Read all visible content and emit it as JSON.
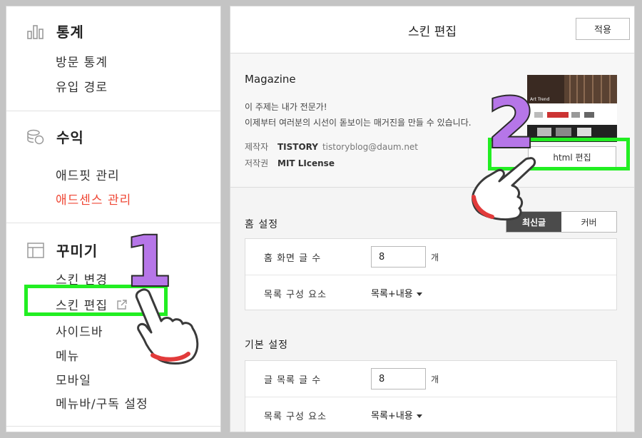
{
  "sidebar": {
    "stats": {
      "title": "통계",
      "icon": "bar-chart-icon",
      "items": [
        "방문 통계",
        "유입 경로"
      ]
    },
    "revenue": {
      "title": "수익",
      "icon": "coins-icon",
      "items": [
        "애드핏 관리",
        "애드센스 관리"
      ]
    },
    "decorate": {
      "title": "꾸미기",
      "icon": "layout-icon",
      "items": [
        "스킨 변경",
        "스킨 편집",
        "사이드바",
        "메뉴",
        "모바일",
        "메뉴바/구독 설정"
      ]
    }
  },
  "header": {
    "title": "스킨 편집",
    "apply_label": "적용"
  },
  "skin": {
    "name": "Magazine",
    "desc_line1": "이 주제는 내가 전문가!",
    "desc_line2": "이제부터 여러분의 시선이 돋보이는 매거진을 만들 수 있습니다.",
    "author_key": "제작자",
    "author": "TISTORY",
    "author_email": "tistoryblog@daum.net",
    "license_key": "저작권",
    "license": "MIT LIcense",
    "thumbnail_text": "Art Trend",
    "html_edit_label": "html 편집"
  },
  "home_settings": {
    "title": "홈 설정",
    "tabs": [
      "최신글",
      "커버"
    ],
    "active_tab": "최신글",
    "rows": {
      "count_label": "홈 화면 글 수",
      "count_value": "8",
      "count_unit": "개",
      "compose_label": "목록 구성 요소",
      "compose_value": "목록+내용"
    }
  },
  "basic_settings": {
    "title": "기본 설정",
    "rows": {
      "count_label": "글 목록 글 수",
      "count_value": "8",
      "count_unit": "개",
      "compose_label": "목록 구성 요소",
      "compose_value": "목록+내용"
    }
  },
  "annotations": {
    "step1": "1",
    "step2": "2",
    "highlight_color": "#22ee22",
    "number_color": "#b676e8"
  },
  "colors": {
    "adsense_red": "#ef4836",
    "active_tab": "#4b4b4b"
  }
}
